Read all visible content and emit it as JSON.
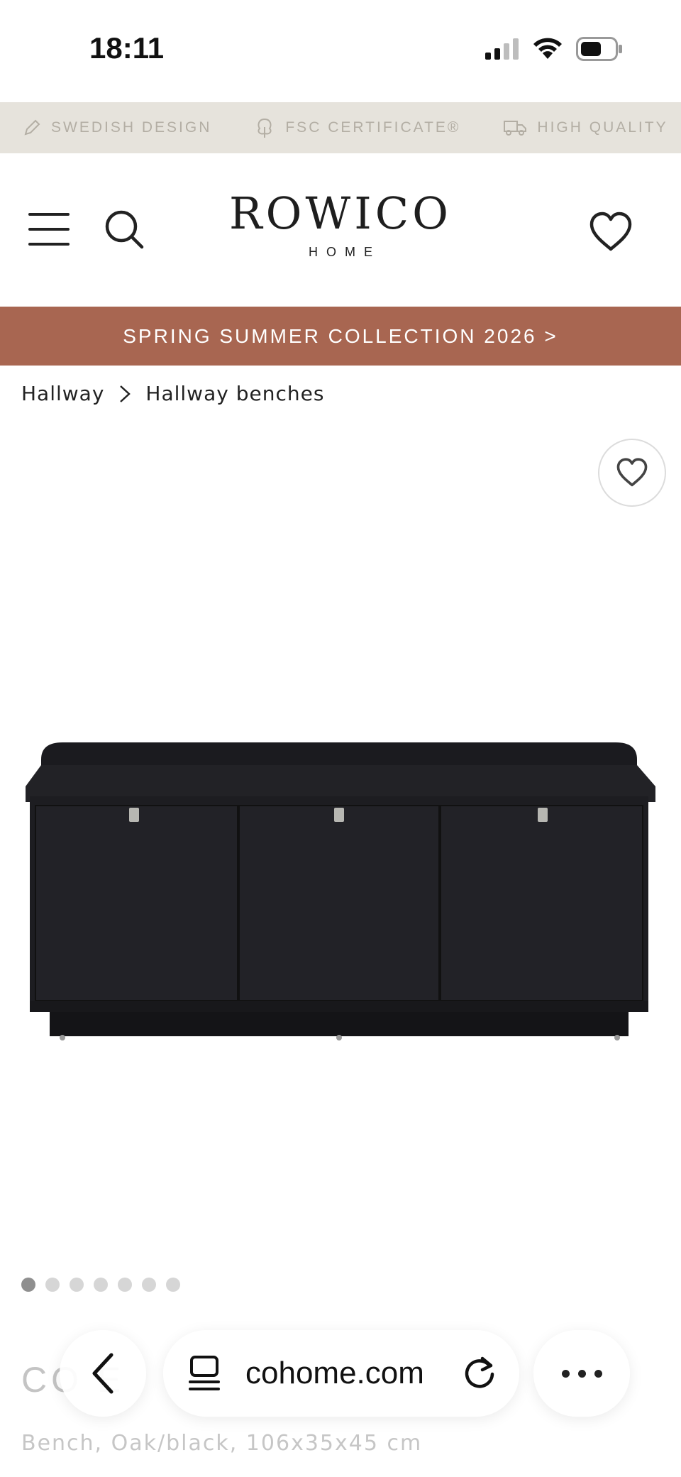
{
  "status_bar": {
    "time": "18:11"
  },
  "usp": [
    {
      "icon": "pencil-icon",
      "label": "SWEDISH DESIGN"
    },
    {
      "icon": "tree-icon",
      "label": "FSC CERTIFICATE®"
    },
    {
      "icon": "truck-icon",
      "label": "HIGH QUALITY"
    }
  ],
  "header": {
    "logo_main": "ROWICO",
    "logo_sub": "HOME"
  },
  "promo": {
    "label": "SPRING SUMMER COLLECTION 2026 >"
  },
  "breadcrumb": {
    "items": [
      "Hallway",
      "Hallway benches"
    ]
  },
  "gallery": {
    "image_count": 7,
    "active_index": 0
  },
  "product": {
    "name_partial": "CO  E  ",
    "subtitle": "Bench, Oak/black, 106x35x45 cm"
  },
  "browser": {
    "url": "cohome.com"
  },
  "colors": {
    "promo": "#a86651",
    "usp_bg": "#e6e3dc",
    "usp_text": "#b3aea4"
  }
}
